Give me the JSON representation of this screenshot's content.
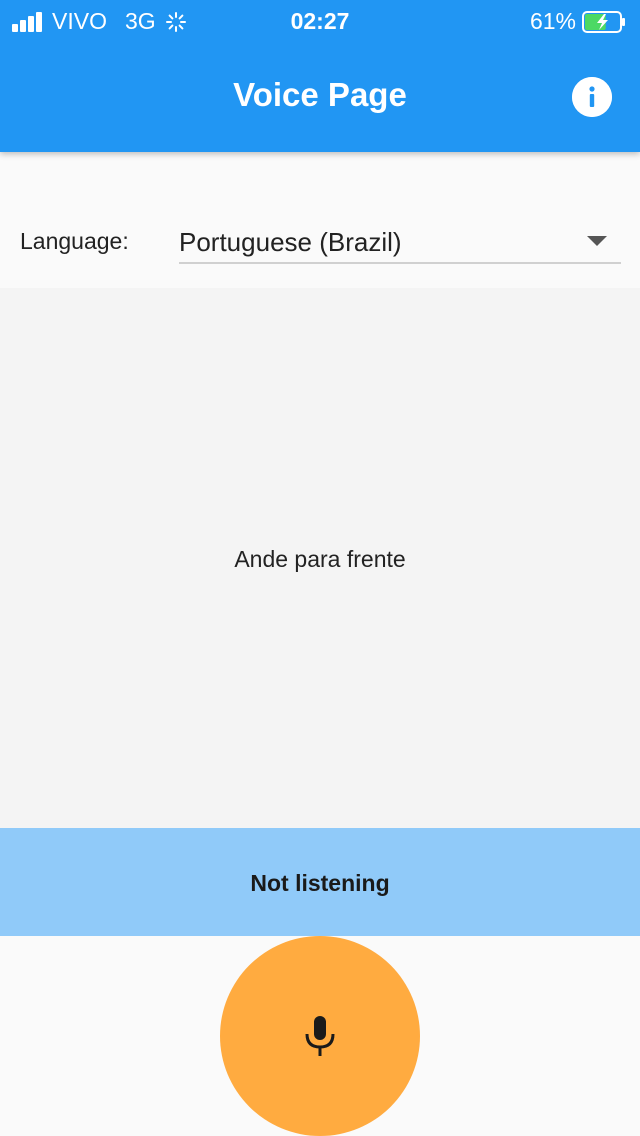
{
  "status_bar": {
    "carrier": "VIVO",
    "network": "3G",
    "time": "02:27",
    "battery": "61%",
    "battery_level": 0.61,
    "battery_color": "#4cd964"
  },
  "app_bar": {
    "title": "Voice Page",
    "background": "#2196f3",
    "info_icon": "info-icon"
  },
  "language": {
    "label": "Language:",
    "selected": "Portuguese (Brazil)"
  },
  "transcript": {
    "text": "Ande para frente"
  },
  "listening_status": {
    "text": "Not listening",
    "background": "#90caf9"
  },
  "mic": {
    "icon": "microphone-icon",
    "color": "#ffab40"
  }
}
